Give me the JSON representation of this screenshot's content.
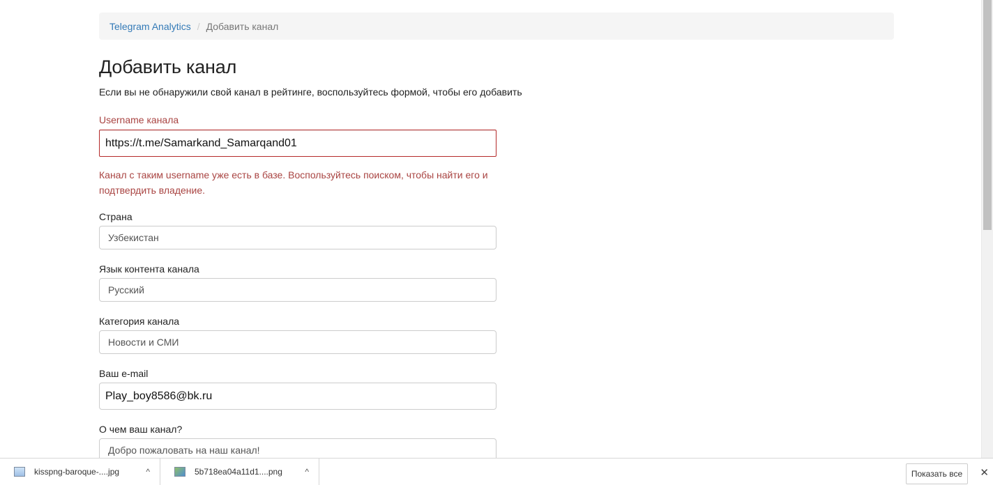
{
  "breadcrumb": {
    "home": "Telegram Analytics",
    "separator": "/",
    "current": "Добавить канал"
  },
  "page": {
    "title": "Добавить канал",
    "intro": "Если вы не обнаружили свой канал в рейтинге, воспользуйтесь формой, чтобы его добавить"
  },
  "form": {
    "username": {
      "label": "Username канала",
      "value": "https://t.me/Samarkand_Samarqand01",
      "error": "Канал с таким username уже есть в базе. Воспользуйтесь поиском, чтобы найти его и подтвердить владение."
    },
    "country": {
      "label": "Страна",
      "value": "Узбекистан"
    },
    "language": {
      "label": "Язык контента канала",
      "value": "Русский"
    },
    "category": {
      "label": "Категория канала",
      "value": "Новости и СМИ"
    },
    "email": {
      "label": "Ваш e-mail",
      "value": "Play_boy8586@bk.ru"
    },
    "about": {
      "label": "О чем ваш канал?",
      "value": "Добро пожаловать на наш канал!"
    }
  },
  "downloads": {
    "items": [
      {
        "name": "kisspng-baroque-....jpg",
        "icon": "image-file-icon"
      },
      {
        "name": "5b718ea04a11d1....png",
        "icon": "image-file-icon"
      }
    ],
    "show_all": "Показать все",
    "close": "✕",
    "chevron": "^"
  },
  "colors": {
    "link": "#337ab7",
    "error": "#a94442",
    "error_border": "#b52a2a",
    "breadcrumb_bg": "#f5f5f5"
  }
}
